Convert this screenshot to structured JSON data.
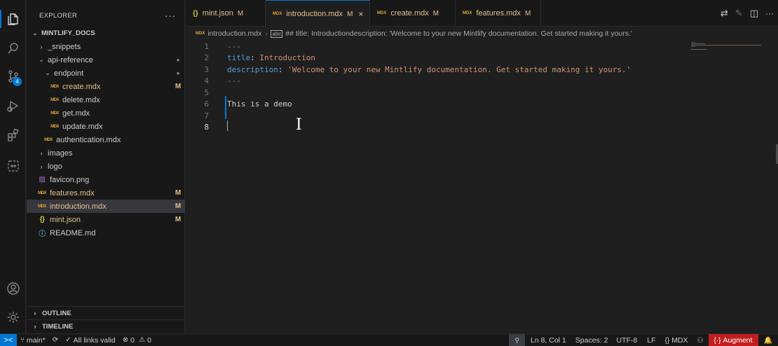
{
  "sidebar": {
    "title": "EXPLORER",
    "more": "···",
    "root": "MINTLIFY_DOCS",
    "items": [
      {
        "label": "_snippets",
        "type": "folder",
        "expanded": false,
        "depth": 1
      },
      {
        "label": "api-reference",
        "type": "folder",
        "expanded": true,
        "depth": 1,
        "dot": "●"
      },
      {
        "label": "endpoint",
        "type": "folder",
        "expanded": true,
        "depth": 2,
        "dot": "●"
      },
      {
        "label": "create.mdx",
        "type": "mdx",
        "depth": 3,
        "status": "M"
      },
      {
        "label": "delete.mdx",
        "type": "mdx",
        "depth": 3
      },
      {
        "label": "get.mdx",
        "type": "mdx",
        "depth": 3
      },
      {
        "label": "update.mdx",
        "type": "mdx",
        "depth": 3
      },
      {
        "label": "authentication.mdx",
        "type": "mdx",
        "depth": 2
      },
      {
        "label": "images",
        "type": "folder",
        "expanded": false,
        "depth": 1
      },
      {
        "label": "logo",
        "type": "folder",
        "expanded": false,
        "depth": 1
      },
      {
        "label": "favicon.png",
        "type": "png",
        "depth": 1
      },
      {
        "label": "features.mdx",
        "type": "mdx",
        "depth": 1,
        "status": "M"
      },
      {
        "label": "introduction.mdx",
        "type": "mdx",
        "depth": 1,
        "status": "M",
        "selected": true
      },
      {
        "label": "mint.json",
        "type": "json",
        "depth": 1,
        "status": "M"
      },
      {
        "label": "README.md",
        "type": "info",
        "depth": 1
      }
    ],
    "outline": "OUTLINE",
    "timeline": "TIMELINE"
  },
  "activity": {
    "scm_badge": "4",
    "icons": [
      "files-icon",
      "search-icon",
      "source-control-icon",
      "run-debug-icon",
      "extensions-icon",
      "remote-icon",
      "account-icon",
      "settings-gear-icon"
    ]
  },
  "tabs": [
    {
      "label": "mint.json",
      "icon": "json",
      "status": "M"
    },
    {
      "label": "introduction.mdx",
      "icon": "mdx",
      "status": "M",
      "active": true
    },
    {
      "label": "create.mdx",
      "icon": "mdx",
      "status": "M"
    },
    {
      "label": "features.mdx",
      "icon": "mdx",
      "status": "M"
    }
  ],
  "breadcrumb": {
    "file": "introduction.mdx",
    "symbol": "## title: Introductiondescription: 'Welcome to your new Mintlify documentation. Get started making it yours.'"
  },
  "editor": {
    "current_line": 8,
    "lines": [
      {
        "n": "1",
        "text": "---"
      },
      {
        "n": "2",
        "key": "title",
        "value": "Introduction"
      },
      {
        "n": "3",
        "key": "description",
        "value": "'Welcome to your new Mintlify documentation. Get started making it yours.'"
      },
      {
        "n": "4",
        "text": "---"
      },
      {
        "n": "5",
        "text": ""
      },
      {
        "n": "6",
        "text": "This is a demo"
      },
      {
        "n": "7",
        "text": ""
      },
      {
        "n": "8",
        "text": ""
      }
    ]
  },
  "status": {
    "remote": "><",
    "branch": "main*",
    "sync": "⟳",
    "links": "All links valid",
    "errors": "0",
    "warnings": "0",
    "zoom": "🔍",
    "position": "Ln 8, Col 1",
    "spaces": "Spaces: 2",
    "encoding": "UTF-8",
    "eol": "LF",
    "language": "MDX",
    "augment": "Augment"
  },
  "colors": {
    "accent": "#0078d4",
    "modified": "#e2c08d",
    "augment": "#c21e1e"
  }
}
